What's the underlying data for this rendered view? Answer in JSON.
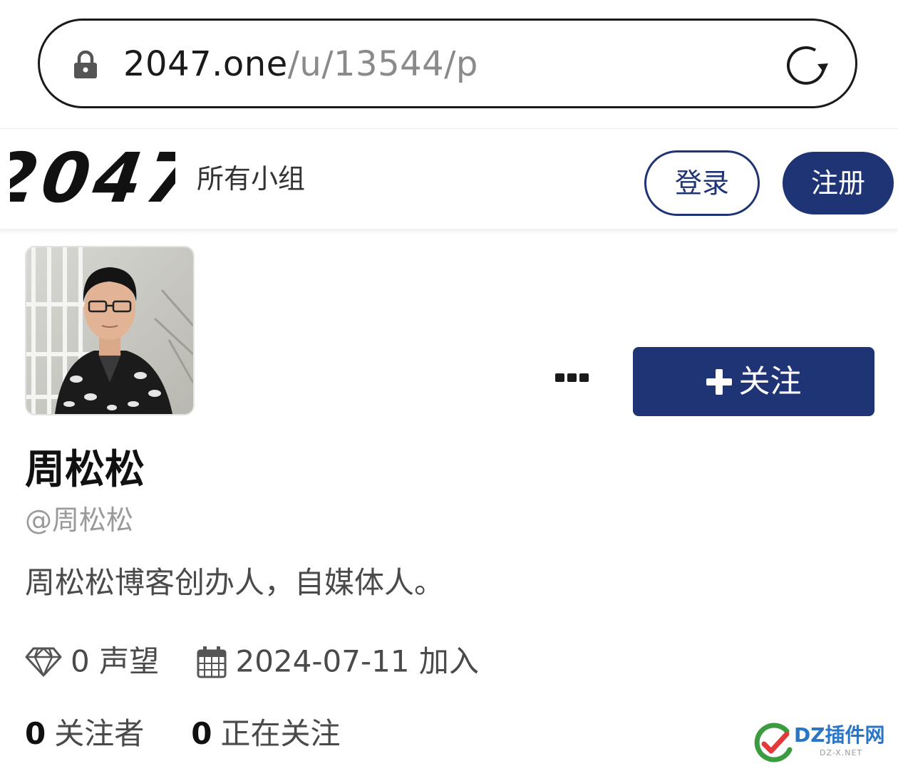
{
  "browser": {
    "url_domain": "2047.one",
    "url_path": "/u/13544/p"
  },
  "header": {
    "logo_text": "2047",
    "nav_all_groups": "所有小组",
    "login_label": "登录",
    "register_label": "注册"
  },
  "profile": {
    "display_name": "周松松",
    "handle": "@周松松",
    "bio": "周松松博客创办人，自媒体人。",
    "follow_label": "关注",
    "reputation_value": "0",
    "reputation_label": "声望",
    "join_date": "2024-07-11",
    "join_label": "加入",
    "followers_count": "0",
    "followers_label": "关注者",
    "following_count": "0",
    "following_label": "正在关注"
  },
  "watermark": {
    "text": "DZ插件网",
    "sub": "DZ-X.NET"
  },
  "colors": {
    "brand_navy": "#1f3474",
    "watermark_blue": "#2a76c6"
  },
  "icons": [
    "lock-icon",
    "reload-icon",
    "more-icon",
    "plus-icon",
    "diamond-icon",
    "calendar-icon"
  ]
}
